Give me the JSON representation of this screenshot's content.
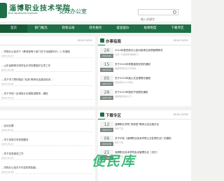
{
  "header": {
    "school_cn": "淄博职业技术学院",
    "school_en": "Zibo Vocational Institute",
    "office": "党政办公室",
    "search_placeholder": "输入关键字"
  },
  "nav": {
    "items": [
      {
        "label": "首页",
        "active": true
      },
      {
        "label": "部门概况",
        "active": false
      },
      {
        "label": "政策法规",
        "active": false
      },
      {
        "label": "政务服务",
        "active": false
      },
      {
        "label": "督查督办",
        "active": false
      },
      {
        "label": "规章制度",
        "active": false
      },
      {
        "label": "下载专区",
        "active": false
      }
    ]
  },
  "news": {
    "read_more": "READ MORE",
    "items": [
      {
        "title": "…学院办公室关于《教育部等十部门关于加强新时代…》的通知",
        "date": "2024-04-12"
      },
      {
        "title": "…山东省精神文明学会办学校要做好五项工作",
        "date": "2024-04-08"
      },
      {
        "title": "…关于学习贯彻落实“双减”教师队伍建设培训…",
        "date": "2024-03-26"
      },
      {
        "title": "…关于市场一区域统计协调推进教育…通知",
        "date": "2024-03-19"
      }
    ]
  },
  "notice": {
    "title": "办事指南",
    "read_more": "READ MORE",
    "items": [
      {
        "title": "2024年度党政办公室对各单位依规管理情况",
        "summary": "为进一步加强学院各部门…",
        "day": "26",
        "ym": "2024-01"
      },
      {
        "title": "关于2024年寒假值班安排的通知",
        "summary": "根据学院有关工作安排…",
        "day": "15",
        "ym": "2024-01"
      },
      {
        "title": "关于2023年度公文处理情况通报",
        "summary": "现将学院2023年度…",
        "day": "05",
        "ym": "2023-12"
      },
      {
        "title": "关于2023年国庆节放假的通知",
        "summary": "根据国务院办公厅…",
        "day": "28",
        "ym": "2023-09"
      }
    ]
  },
  "left_bottom": {
    "items": [
      {
        "title": "…会议纪要",
        "date": "2024-04-10"
      },
      {
        "title": "…关于加强平安校园建设",
        "date": "2024-03-22"
      },
      {
        "title": "…关于信息报送工作",
        "date": "2024-03-10"
      },
      {
        "title": "…学院办公室关于印发规章制度…",
        "date": "2024-02-28"
      }
    ]
  },
  "download": {
    "title": "下载专区",
    "read_more": "READ MORE",
    "items": [
      {
        "title": "淄博职业学院“双师型”教师认定实施办法",
        "summary": "附件下载",
        "day": "12",
        "ym": "2023-10"
      },
      {
        "title": "关于印发《淄博职业技术学院公文处理办法》的通知",
        "summary": "附件下载",
        "day": "06",
        "ym": "2023-09"
      },
      {
        "title": "淄博职业技术学院会议管理办法（试行）",
        "summary": "附件下载",
        "day": "21",
        "ym": "2023-06"
      }
    ]
  },
  "watermark": "便民库"
}
